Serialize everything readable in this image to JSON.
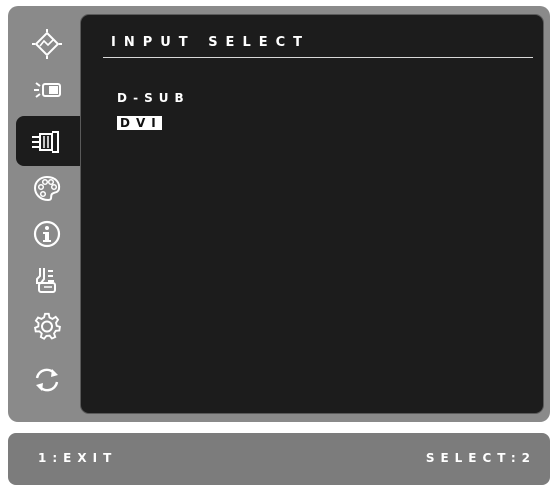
{
  "menu": {
    "items": [
      {
        "icon": "auto-adjust-icon",
        "active": false
      },
      {
        "icon": "contrast-brightness-icon",
        "active": false
      },
      {
        "icon": "input-select-icon",
        "active": true
      },
      {
        "icon": "color-adjust-icon",
        "active": false
      },
      {
        "icon": "information-icon",
        "active": false
      },
      {
        "icon": "manual-image-adjust-icon",
        "active": false
      },
      {
        "icon": "setup-menu-icon",
        "active": false
      },
      {
        "icon": "memory-recall-icon",
        "active": false
      }
    ]
  },
  "panel": {
    "title": "INPUT SELECT",
    "options": [
      {
        "label": "D-SUB",
        "selected": false
      },
      {
        "label": "DVI",
        "selected": true
      }
    ]
  },
  "status": {
    "left": "1:EXIT",
    "right_label": "SELECT:",
    "right_key": "2"
  },
  "colors": {
    "frame": "#8a8a8a",
    "panel": "#1c1c1c",
    "highlight": "#ffffff",
    "status_bar": "#7c7c7c"
  }
}
